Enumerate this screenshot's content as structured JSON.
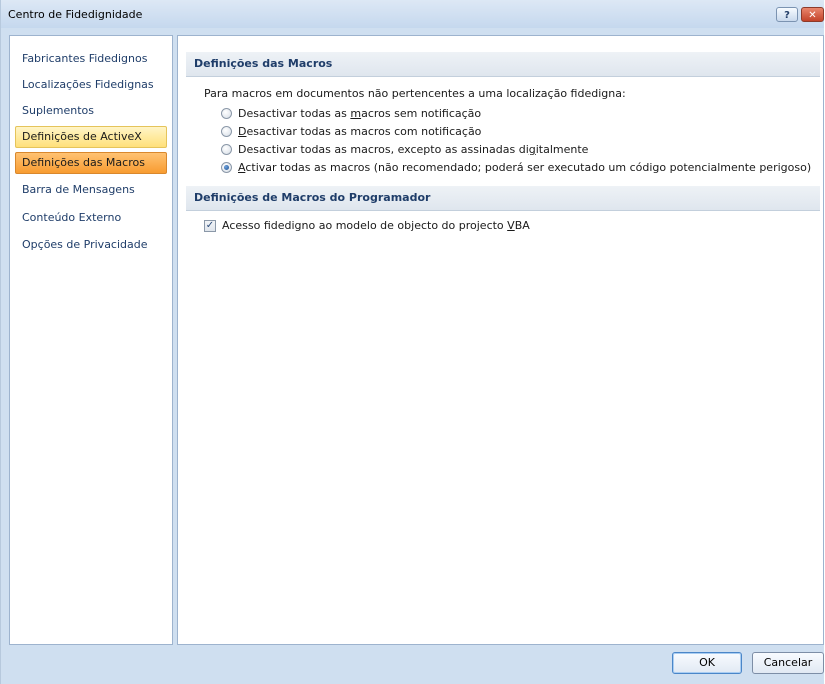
{
  "window": {
    "title": "Centro de Fidedignidade",
    "help_button": "?",
    "close_button": "✕"
  },
  "sidebar": {
    "items": [
      {
        "label": "Fabricantes Fidedignos",
        "state": "normal"
      },
      {
        "label": "Localizações Fidedignas",
        "state": "normal"
      },
      {
        "label": "Suplementos",
        "state": "normal"
      },
      {
        "label": "Definições de ActiveX",
        "state": "hover"
      },
      {
        "label": "Definições das Macros",
        "state": "selected"
      },
      {
        "label": "Barra de Mensagens",
        "state": "normal"
      },
      {
        "label": "Conteúdo Externo",
        "state": "normal"
      },
      {
        "label": "Opções de Privacidade",
        "state": "normal"
      }
    ]
  },
  "macros_section": {
    "header": "Definições das Macros",
    "intro": "Para macros em documentos não pertencentes a uma localização fidedigna:",
    "options": [
      {
        "pre": "Desactivar todas as ",
        "key": "m",
        "post": "acros sem notificação",
        "checked": false
      },
      {
        "pre": "",
        "key": "D",
        "post": "esactivar todas as macros com notificação",
        "checked": false
      },
      {
        "pre": "Desactivar todas as macros, excepto as assinadas di",
        "key": "g",
        "post": "italmente",
        "checked": false
      },
      {
        "pre": "",
        "key": "A",
        "post": "ctivar todas as macros (não recomendado; poderá ser executado um código potencialmente perigoso)",
        "checked": true
      }
    ]
  },
  "developer_section": {
    "header": "Definições de Macros do Programador",
    "checkbox": {
      "pre": "Acesso fidedigno ao modelo de objecto do projecto ",
      "key": "V",
      "post": "BA",
      "checked": true,
      "mark": "✓"
    }
  },
  "footer": {
    "ok_label": "OK",
    "cancel_label": "Cancelar"
  },
  "colors": {
    "accent_selected": "#f89c31",
    "accent_hover": "#ffe07a",
    "link_blue": "#1f3d69"
  }
}
